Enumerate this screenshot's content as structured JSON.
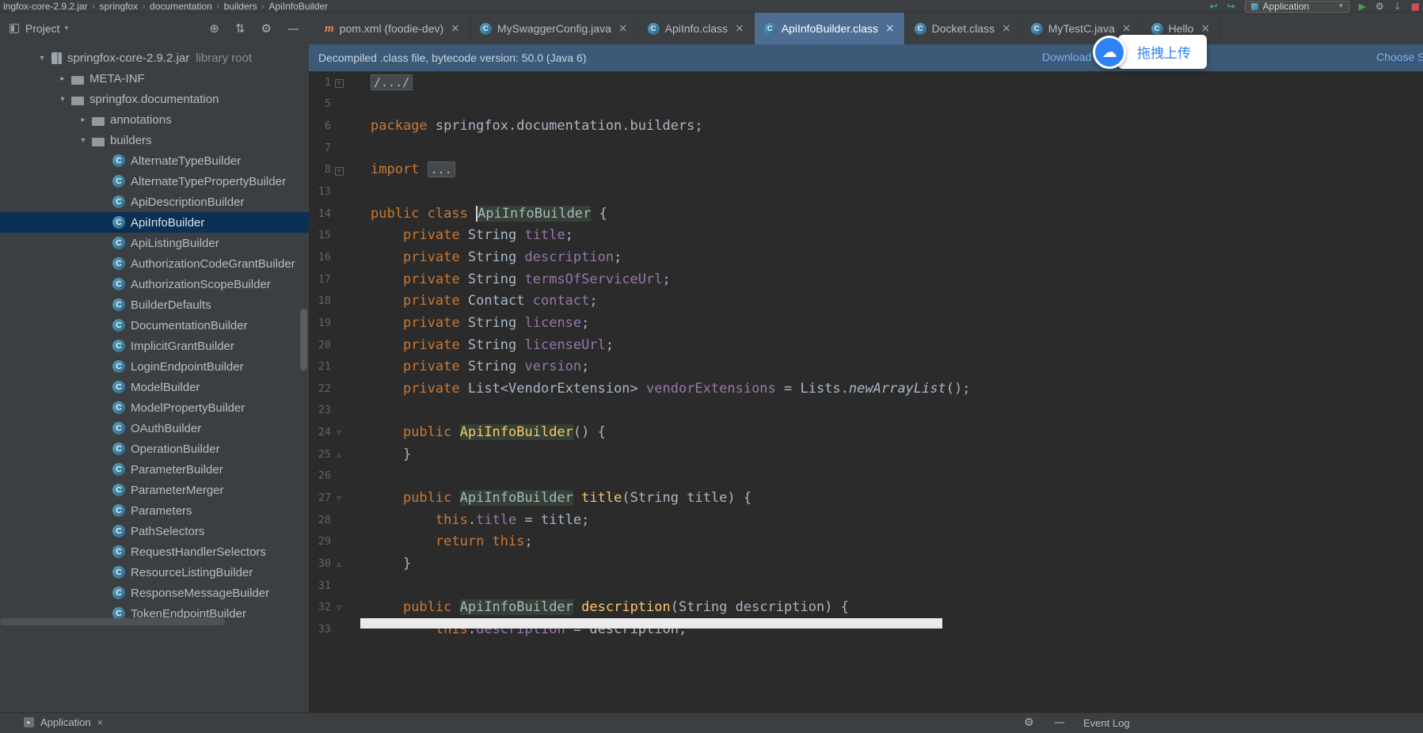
{
  "titlebar": {
    "breadcrumbs": [
      "ingfox-core-2.9.2.jar",
      "springfox",
      "documentation",
      "builders",
      "ApiInfoBuilder"
    ],
    "run_config": {
      "label": "Application"
    },
    "nav_icons": [
      {
        "name": "back-icon",
        "glyph": "↩",
        "color": "#4db6ac"
      },
      {
        "name": "forward-icon",
        "glyph": "↪",
        "color": "#4db6ac"
      }
    ],
    "action_icons": [
      {
        "name": "run-icon",
        "glyph": "▶",
        "color": "#499c54"
      },
      {
        "name": "settings-icon",
        "glyph": "⚙",
        "color": "#afb1b3"
      },
      {
        "name": "update-icon",
        "glyph": "↓",
        "color": "#6897bb"
      },
      {
        "name": "stop-icon",
        "glyph": "■",
        "color": "#c75450"
      }
    ]
  },
  "project_panel": {
    "title": "Project",
    "header_caret": "▾",
    "header_icons": [
      {
        "name": "locate-file-icon",
        "glyph": "⊕"
      },
      {
        "name": "scroll-from-source-icon",
        "glyph": "⇅"
      },
      {
        "name": "settings-icon",
        "glyph": "⚙"
      },
      {
        "name": "hide-panel-icon",
        "glyph": "—"
      }
    ],
    "tree": [
      {
        "label": "springfox-core-2.9.2.jar",
        "suffix": "library root",
        "level": 0,
        "icon": "jar",
        "chevron": "expanded"
      },
      {
        "label": "META-INF",
        "level": 1,
        "icon": "folder",
        "chevron": "collapsed"
      },
      {
        "label": "springfox.documentation",
        "level": 1,
        "icon": "folder",
        "chevron": "expanded"
      },
      {
        "label": "annotations",
        "level": 2,
        "icon": "folder",
        "chevron": "collapsed"
      },
      {
        "label": "builders",
        "level": 2,
        "icon": "folder",
        "chevron": "expanded"
      },
      {
        "label": "AlternateTypeBuilder",
        "level": 3,
        "icon": "class"
      },
      {
        "label": "AlternateTypePropertyBuilder",
        "level": 3,
        "icon": "class"
      },
      {
        "label": "ApiDescriptionBuilder",
        "level": 3,
        "icon": "class"
      },
      {
        "label": "ApiInfoBuilder",
        "level": 3,
        "icon": "class",
        "selected": true
      },
      {
        "label": "ApiListingBuilder",
        "level": 3,
        "icon": "class"
      },
      {
        "label": "AuthorizationCodeGrantBuilder",
        "level": 3,
        "icon": "class"
      },
      {
        "label": "AuthorizationScopeBuilder",
        "level": 3,
        "icon": "class"
      },
      {
        "label": "BuilderDefaults",
        "level": 3,
        "icon": "class"
      },
      {
        "label": "DocumentationBuilder",
        "level": 3,
        "icon": "class"
      },
      {
        "label": "ImplicitGrantBuilder",
        "level": 3,
        "icon": "class"
      },
      {
        "label": "LoginEndpointBuilder",
        "level": 3,
        "icon": "class"
      },
      {
        "label": "ModelBuilder",
        "level": 3,
        "icon": "class"
      },
      {
        "label": "ModelPropertyBuilder",
        "level": 3,
        "icon": "class"
      },
      {
        "label": "OAuthBuilder",
        "level": 3,
        "icon": "class"
      },
      {
        "label": "OperationBuilder",
        "level": 3,
        "icon": "class"
      },
      {
        "label": "ParameterBuilder",
        "level": 3,
        "icon": "class"
      },
      {
        "label": "ParameterMerger",
        "level": 3,
        "icon": "class"
      },
      {
        "label": "Parameters",
        "level": 3,
        "icon": "class"
      },
      {
        "label": "PathSelectors",
        "level": 3,
        "icon": "class"
      },
      {
        "label": "RequestHandlerSelectors",
        "level": 3,
        "icon": "class"
      },
      {
        "label": "ResourceListingBuilder",
        "level": 3,
        "icon": "class"
      },
      {
        "label": "ResponseMessageBuilder",
        "level": 3,
        "icon": "class"
      },
      {
        "label": "TokenEndpointBuilder",
        "level": 3,
        "icon": "class"
      }
    ]
  },
  "editor": {
    "tabs": [
      {
        "label": "pom.xml (foodie-dev)",
        "icon": "maven"
      },
      {
        "label": "MySwaggerConfig.java",
        "icon": "class"
      },
      {
        "label": "ApiInfo.class",
        "icon": "class"
      },
      {
        "label": "ApiInfoBuilder.class",
        "icon": "class",
        "active": true
      },
      {
        "label": "Docket.class",
        "icon": "class"
      },
      {
        "label": "MyTestC.java",
        "icon": "class"
      },
      {
        "label": "Hello",
        "icon": "class"
      }
    ],
    "notification": {
      "message": "Decompiled .class file, bytecode version: 50.0 (Java 6)",
      "links": [
        {
          "label": "Download Sources",
          "name": "download-sources-link"
        },
        {
          "label": "Choose Sources",
          "name": "choose-sources-link"
        }
      ]
    },
    "lines": [
      {
        "n": "1",
        "fold": "plus",
        "tokens": [
          [
            "folded",
            "/.../"
          ]
        ]
      },
      {
        "n": "5",
        "tokens": []
      },
      {
        "n": "6",
        "tokens": [
          [
            "kw",
            "package "
          ],
          [
            "def",
            "springfox.documentation.builders;"
          ]
        ]
      },
      {
        "n": "7",
        "tokens": []
      },
      {
        "n": "8",
        "fold": "plus",
        "tokens": [
          [
            "kw",
            "import "
          ],
          [
            "folded",
            "..."
          ]
        ]
      },
      {
        "n": "13",
        "tokens": []
      },
      {
        "n": "14",
        "tokens": [
          [
            "kw",
            "public class "
          ],
          [
            "caret",
            ""
          ],
          [
            "hl",
            "ApiInfoBuilder"
          ],
          [
            "def",
            " {"
          ]
        ]
      },
      {
        "n": "15",
        "tokens": [
          [
            "def",
            "    "
          ],
          [
            "kw",
            "private "
          ],
          [
            "def",
            "String "
          ],
          [
            "field",
            "title"
          ],
          [
            "def",
            ";"
          ]
        ]
      },
      {
        "n": "16",
        "tokens": [
          [
            "def",
            "    "
          ],
          [
            "kw",
            "private "
          ],
          [
            "def",
            "String "
          ],
          [
            "field",
            "description"
          ],
          [
            "def",
            ";"
          ]
        ]
      },
      {
        "n": "17",
        "tokens": [
          [
            "def",
            "    "
          ],
          [
            "kw",
            "private "
          ],
          [
            "def",
            "String "
          ],
          [
            "field",
            "termsOfServiceUrl"
          ],
          [
            "def",
            ";"
          ]
        ]
      },
      {
        "n": "18",
        "tokens": [
          [
            "def",
            "    "
          ],
          [
            "kw",
            "private "
          ],
          [
            "def",
            "Contact "
          ],
          [
            "field",
            "contact"
          ],
          [
            "def",
            ";"
          ]
        ]
      },
      {
        "n": "19",
        "tokens": [
          [
            "def",
            "    "
          ],
          [
            "kw",
            "private "
          ],
          [
            "def",
            "String "
          ],
          [
            "field",
            "license"
          ],
          [
            "def",
            ";"
          ]
        ]
      },
      {
        "n": "20",
        "tokens": [
          [
            "def",
            "    "
          ],
          [
            "kw",
            "private "
          ],
          [
            "def",
            "String "
          ],
          [
            "field",
            "licenseUrl"
          ],
          [
            "def",
            ";"
          ]
        ]
      },
      {
        "n": "21",
        "tokens": [
          [
            "def",
            "    "
          ],
          [
            "kw",
            "private "
          ],
          [
            "def",
            "String "
          ],
          [
            "field",
            "version"
          ],
          [
            "def",
            ";"
          ]
        ]
      },
      {
        "n": "22",
        "tokens": [
          [
            "def",
            "    "
          ],
          [
            "kw",
            "private "
          ],
          [
            "def",
            "List<VendorExtension> "
          ],
          [
            "field",
            "vendorExtensions"
          ],
          [
            "def",
            " = Lists."
          ],
          [
            "italic",
            "newArrayList"
          ],
          [
            "def",
            "();"
          ]
        ]
      },
      {
        "n": "23",
        "tokens": []
      },
      {
        "n": "24",
        "fold": "down",
        "tokens": [
          [
            "def",
            "    "
          ],
          [
            "kw",
            "public "
          ],
          [
            "hlm",
            "ApiInfoBuilder"
          ],
          [
            "def",
            "() {"
          ]
        ]
      },
      {
        "n": "25",
        "fold": "up",
        "tokens": [
          [
            "def",
            "    }"
          ]
        ]
      },
      {
        "n": "26",
        "tokens": []
      },
      {
        "n": "27",
        "fold": "down",
        "tokens": [
          [
            "def",
            "    "
          ],
          [
            "kw",
            "public "
          ],
          [
            "hl",
            "ApiInfoBuilder"
          ],
          [
            "def",
            " "
          ],
          [
            "method",
            "title"
          ],
          [
            "def",
            "(String title) {"
          ]
        ]
      },
      {
        "n": "28",
        "tokens": [
          [
            "def",
            "        "
          ],
          [
            "kw",
            "this"
          ],
          [
            "def",
            "."
          ],
          [
            "field",
            "title"
          ],
          [
            "def",
            " = title;"
          ]
        ]
      },
      {
        "n": "29",
        "tokens": [
          [
            "def",
            "        "
          ],
          [
            "kw",
            "return this"
          ],
          [
            "def",
            ";"
          ]
        ]
      },
      {
        "n": "30",
        "fold": "up",
        "tokens": [
          [
            "def",
            "    }"
          ]
        ]
      },
      {
        "n": "31",
        "tokens": []
      },
      {
        "n": "32",
        "fold": "down",
        "tokens": [
          [
            "def",
            "    "
          ],
          [
            "kw",
            "public "
          ],
          [
            "hl",
            "ApiInfoBuilder"
          ],
          [
            "def",
            " "
          ],
          [
            "method",
            "description"
          ],
          [
            "def",
            "(String description) {"
          ]
        ]
      },
      {
        "n": "33",
        "tokens": [
          [
            "def",
            "        "
          ],
          [
            "kw",
            "this"
          ],
          [
            "def",
            "."
          ],
          [
            "field",
            "description"
          ],
          [
            "def",
            " = description;"
          ]
        ]
      }
    ]
  },
  "overlay": {
    "upload_label": "拖拽上传",
    "cloud_icon": "☁"
  },
  "statusbar": {
    "left_tab": {
      "label": "Application",
      "close": "×"
    },
    "icons": [
      {
        "name": "settings-icon",
        "glyph": "⚙"
      },
      {
        "name": "hide-icon",
        "glyph": "—"
      }
    ],
    "event_log": "Event Log"
  }
}
